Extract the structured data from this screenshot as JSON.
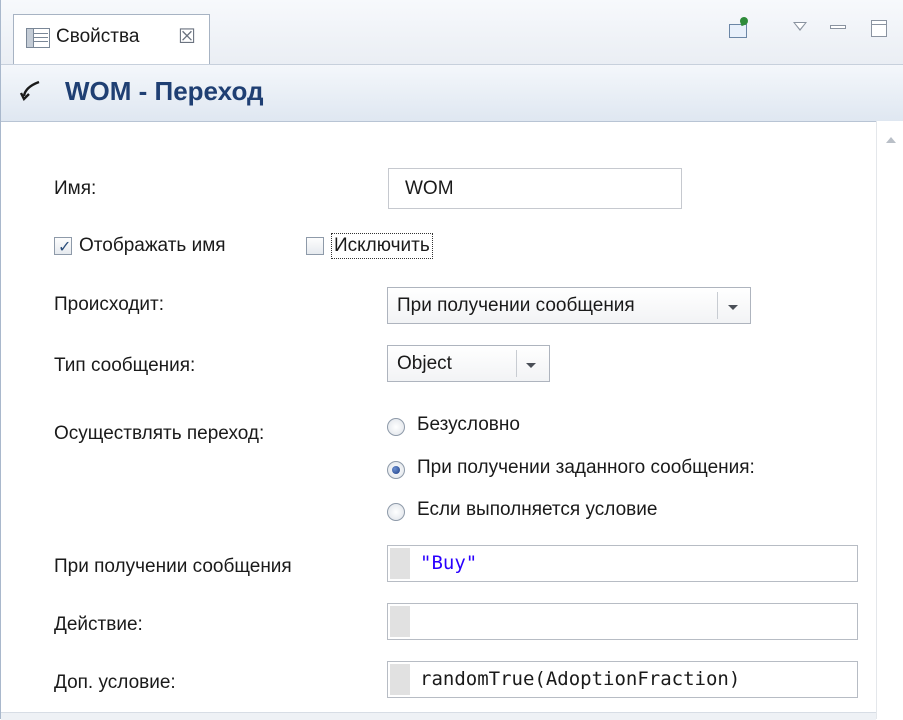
{
  "tab": {
    "title": "Свойства",
    "close_symbol": "☒"
  },
  "toolbar": {
    "pin": "pin",
    "view_menu": "view menu",
    "minimize": "minimize",
    "maximize": "maximize"
  },
  "header": {
    "title": "WOM - Переход"
  },
  "form": {
    "name_label": "Имя:",
    "name_value": "WOM",
    "show_name_label": "Отображать имя",
    "show_name_checked": true,
    "exclude_label": "Исключить",
    "exclude_checked": false,
    "occurs_label": "Происходит:",
    "occurs_value": "При получении сообщения",
    "message_type_label": "Тип сообщения:",
    "message_type_value": "Object",
    "transition_label": "Осуществлять переход:",
    "transition_options": [
      {
        "label": "Безусловно",
        "selected": false
      },
      {
        "label": "При получении заданного сообщения:",
        "selected": true
      },
      {
        "label": "Если выполняется условие",
        "selected": false
      }
    ],
    "on_message_label": "При получении сообщения",
    "on_message_value": "\"Buy\"",
    "action_label": "Действие:",
    "action_value": "",
    "extra_condition_label": "Доп. условие:",
    "extra_condition_value": "randomTrue(AdoptionFraction)"
  },
  "icons": {
    "tab": "properties-view-icon",
    "header": "transition-icon",
    "pin": "pin-icon",
    "menu": "view-menu-icon",
    "minimize": "minimize-icon",
    "maximize": "maximize-icon"
  }
}
